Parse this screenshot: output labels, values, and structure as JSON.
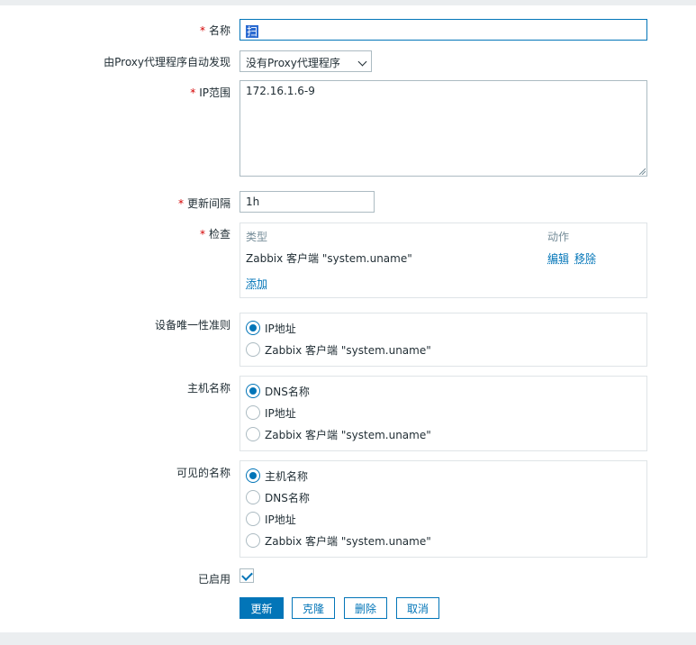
{
  "form": {
    "name": {
      "label": "名称",
      "value": "扫"
    },
    "proxy": {
      "label": "由Proxy代理程序自动发现",
      "selected": "没有Proxy代理程序"
    },
    "ip_range": {
      "label": "IP范围",
      "value": "172.16.1.6-9"
    },
    "update_interval": {
      "label": "更新间隔",
      "value": "1h"
    },
    "checks": {
      "label": "检查",
      "col_type": "类型",
      "col_action": "动作",
      "rows": [
        {
          "type": "Zabbix 客户端 \"system.uname\"",
          "edit": "编辑",
          "remove": "移除"
        }
      ],
      "add": "添加"
    },
    "uniqueness": {
      "label": "设备唯一性准则",
      "options": [
        "IP地址",
        "Zabbix 客户端 \"system.uname\""
      ],
      "selected": 0
    },
    "host_name": {
      "label": "主机名称",
      "options": [
        "DNS名称",
        "IP地址",
        "Zabbix 客户端 \"system.uname\""
      ],
      "selected": 0
    },
    "visible_name": {
      "label": "可见的名称",
      "options": [
        "主机名称",
        "DNS名称",
        "IP地址",
        "Zabbix 客户端 \"system.uname\""
      ],
      "selected": 0
    },
    "enabled": {
      "label": "已启用",
      "checked": true
    }
  },
  "buttons": {
    "update": "更新",
    "clone": "克隆",
    "delete": "删除",
    "cancel": "取消"
  },
  "colors": {
    "accent": "#0275b8",
    "required": "#d40000",
    "border": "#acbbc2",
    "background": "#ebeef0"
  }
}
